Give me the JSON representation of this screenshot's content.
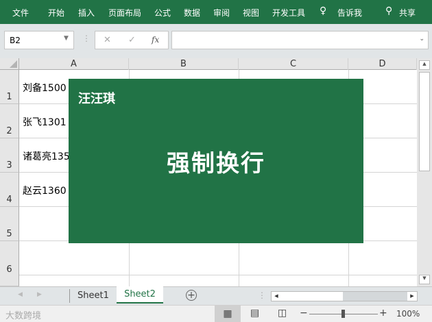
{
  "menu": {
    "items": [
      "文件",
      "开始",
      "插入",
      "页面布局",
      "公式",
      "数据",
      "审阅",
      "视图",
      "开发工具"
    ],
    "tell_me": "告诉我",
    "share": "共享"
  },
  "formula_bar": {
    "name_box": "B2",
    "cancel": "✕",
    "enter": "✓",
    "fx": "fx",
    "formula": ""
  },
  "columns": [
    "A",
    "B",
    "C",
    "D"
  ],
  "rows": [
    "1",
    "2",
    "3",
    "4",
    "5",
    "6"
  ],
  "cells": [
    "刘备1500",
    "张飞1301",
    "诸葛亮135",
    "赵云1360"
  ],
  "overlay": {
    "author": "汪汪琪",
    "title": "强制换行",
    "color": "#217346"
  },
  "sheets": {
    "tabs": [
      "Sheet1",
      "Sheet2"
    ],
    "active": "Sheet2"
  },
  "status": {
    "watermark": "大数跨境",
    "zoom": "100%"
  }
}
